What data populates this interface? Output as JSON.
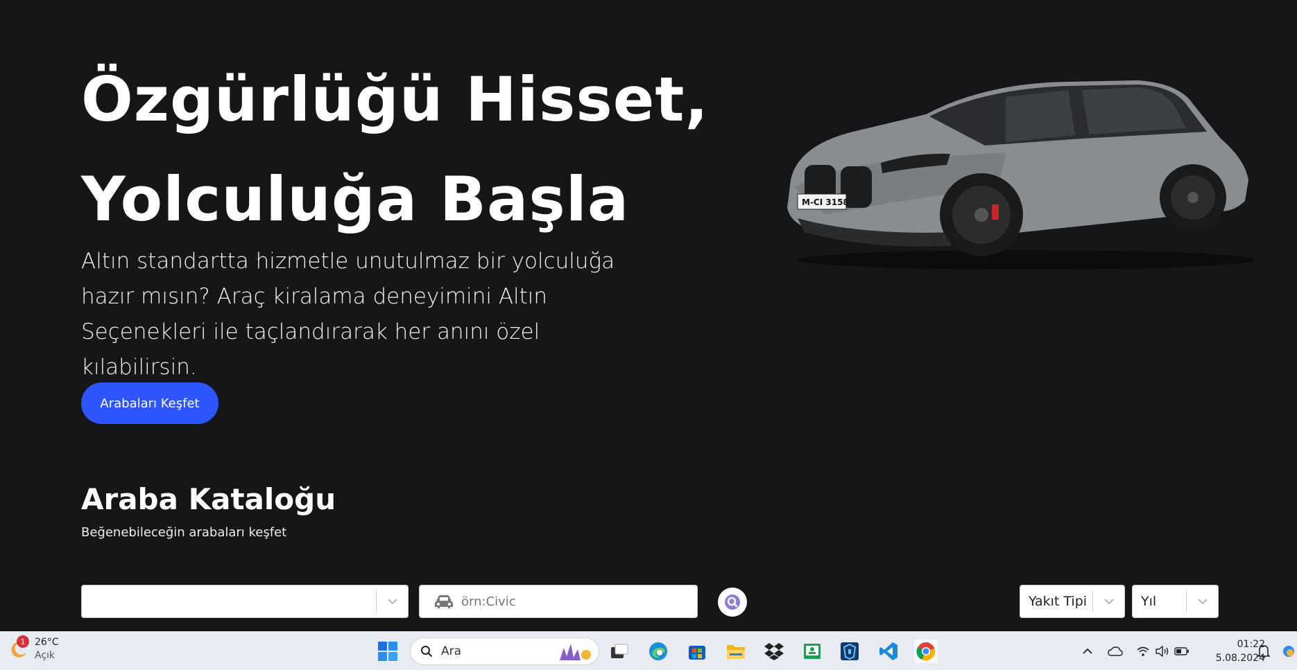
{
  "hero": {
    "title_line1": "Özgürlüğü Hisset,",
    "title_line2": "Yolculuğa Başla",
    "description": "Altın standartta hizmetle unutulmaz bir yolculuğa hazır mısın? Araç kiralama deneyimini Altın Seçenekleri ile taçlandırarak her anını özel kılabilirsin.",
    "cta_label": "Arabaları Keşfet",
    "car_plate": "M-CI 3158"
  },
  "catalog": {
    "title": "Araba Kataloğu",
    "subtitle": "Beğenebileceğin arabaları keşfet",
    "brand_select_value": "",
    "model_placeholder": "örn:Civic",
    "fuel_select_label": "Yakıt Tipi",
    "year_select_label": "Yıl"
  },
  "taskbar": {
    "weather_temp": "26°C",
    "weather_condition": "Açık",
    "weather_badge": "1",
    "search_label": "Ara",
    "time": "01:22",
    "date": "5.08.2024"
  },
  "colors": {
    "background": "#161517",
    "accent": "#2f55ff"
  }
}
